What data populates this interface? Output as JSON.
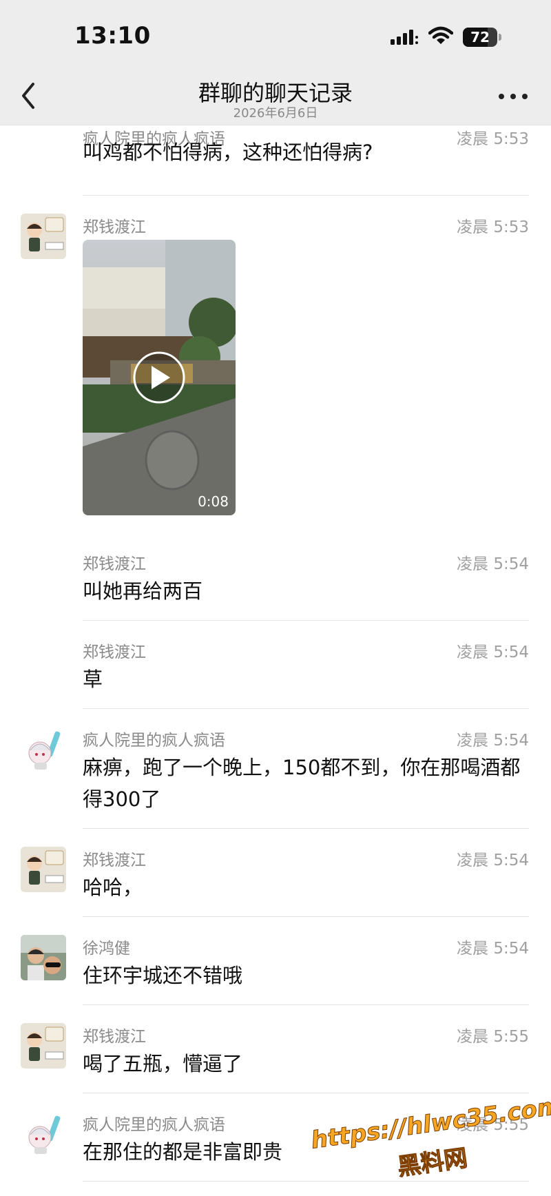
{
  "status_bar": {
    "time": "13:10",
    "battery": "72",
    "battery_level": 0.72
  },
  "nav": {
    "title": "群聊的聊天记录",
    "subtitle": "2026年6月6日",
    "back_icon": "chevron-left-icon",
    "more_icon": "ellipsis-icon"
  },
  "messages": [
    {
      "sender": "疯人院里的疯人疯语",
      "time": "凌晨 5:53",
      "text": "叫鸡都不怕得病，这种还怕得病?"
    },
    {
      "sender": "郑钱渡江",
      "time": "凌晨 5:53",
      "video_duration": "0:08"
    },
    {
      "sender": "郑钱渡江",
      "time": "凌晨 5:54",
      "text": "叫她再给两百"
    },
    {
      "sender": "郑钱渡江",
      "time": "凌晨 5:54",
      "text": "草"
    },
    {
      "sender": "疯人院里的疯人疯语",
      "time": "凌晨 5:54",
      "text": "麻痹，跑了一个晚上，150都不到，你在那喝酒都得300了"
    },
    {
      "sender": "郑钱渡江",
      "time": "凌晨 5:54",
      "text": "哈哈，"
    },
    {
      "sender": "徐鸿健",
      "time": "凌晨 5:54",
      "text": "住环宇城还不错哦"
    },
    {
      "sender": "郑钱渡江",
      "time": "凌晨 5:55",
      "text": "喝了五瓶，懵逼了"
    },
    {
      "sender": "疯人院里的疯人疯语",
      "time": "凌晨 5:55",
      "text": "在那住的都是非富即贵"
    }
  ],
  "watermark": {
    "url": "https://hlwc35.com",
    "name": "黑料网"
  },
  "colors": {
    "header_bg": "#ededed",
    "secondary_text": "#8a8a8a",
    "watermark": "#f6a623"
  }
}
